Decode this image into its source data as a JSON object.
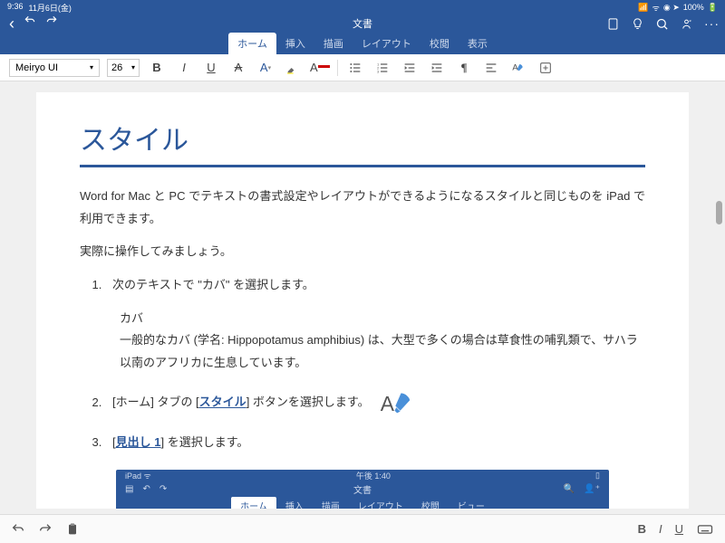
{
  "status": {
    "time": "9:36",
    "date": "11月6日(金)",
    "battery": "100%"
  },
  "doc": {
    "title": "文書"
  },
  "nav": {
    "back": "‹"
  },
  "tabs": [
    {
      "label": "ホーム",
      "active": true
    },
    {
      "label": "挿入",
      "active": false
    },
    {
      "label": "描画",
      "active": false
    },
    {
      "label": "レイアウト",
      "active": false
    },
    {
      "label": "校閲",
      "active": false
    },
    {
      "label": "表示",
      "active": false
    }
  ],
  "toolbar": {
    "font": "Meiryo UI",
    "size": "26"
  },
  "content": {
    "heading": "スタイル",
    "intro": "Word for Mac と PC でテキストの書式設定やレイアウトができるようになるスタイルと同じものを iPad で利用できます。",
    "lead": "実際に操作してみましょう。",
    "step1": "次のテキストで \"カバ\" を選択します。",
    "sample_title": "カバ",
    "sample_body": "一般的なカバ (学名: Hippopotamus amphibius) は、大型で多くの場合は草食性の哺乳類で、サハラ以南のアフリカに生息しています。",
    "step2_a": "[ホーム] タブの [",
    "step2_link": "スタイル",
    "step2_b": "] ボタンを選択します。",
    "step3_a": "[",
    "step3_link": "見出し 1",
    "step3_b": "] を選択します。"
  },
  "inner": {
    "device": "iPad",
    "wifi": "ᯤ",
    "time": "午後 1:40",
    "title": "文書",
    "tabs": [
      "ホーム",
      "挿入",
      "描画",
      "レイアウト",
      "校閲",
      "ビュー"
    ]
  },
  "bottom": {
    "bold": "B",
    "italic": "I",
    "underline": "U"
  }
}
